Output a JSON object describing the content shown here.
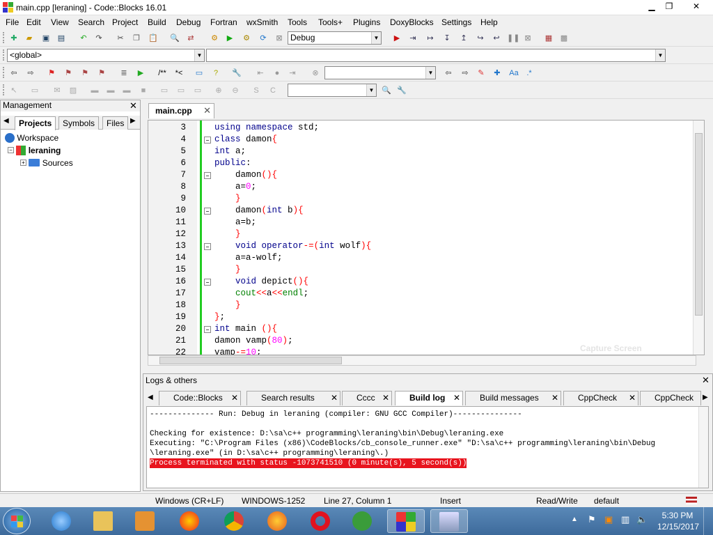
{
  "window": {
    "title": "main.cpp [leraning] - Code::Blocks 16.01"
  },
  "menu": [
    "File",
    "Edit",
    "View",
    "Search",
    "Project",
    "Build",
    "Debug",
    "Fortran",
    "wxSmith",
    "Tools",
    "Tools+",
    "Plugins",
    "DoxyBlocks",
    "Settings",
    "Help"
  ],
  "toolbar": {
    "build_target": "Debug",
    "scope": "<global>",
    "symbol": ""
  },
  "management": {
    "title": "Management",
    "tabs": [
      "Projects",
      "Symbols",
      "Files"
    ],
    "workspace": "Workspace",
    "project": "leraning",
    "folder": "Sources"
  },
  "editor": {
    "tab": "main.cpp",
    "lines": [
      {
        "n": "3",
        "html": "<span class='kw'>using</span> <span class='kw'>namespace</span> std;"
      },
      {
        "n": "4",
        "html": "<span class='kw'>class</span> damon<span class='op'>{</span>"
      },
      {
        "n": "5",
        "html": "<span class='ty'>int</span> a;"
      },
      {
        "n": "6",
        "html": "<span class='kw'>public</span>:"
      },
      {
        "n": "7",
        "html": "    damon<span class='op'>(){</span>"
      },
      {
        "n": "8",
        "html": "    a=<span class='num'>0</span>;"
      },
      {
        "n": "9",
        "html": "    <span class='op'>}</span>"
      },
      {
        "n": "10",
        "html": "    damon<span class='op'>(</span><span class='ty'>int</span> b<span class='op'>){</span>"
      },
      {
        "n": "11",
        "html": "    a=b;"
      },
      {
        "n": "12",
        "html": "    <span class='op'>}</span>"
      },
      {
        "n": "13",
        "html": "    <span class='ty'>void</span> <span class='kw'>operator</span><span class='op'>-=(</span><span class='ty'>int</span> wolf<span class='op'>){</span>"
      },
      {
        "n": "14",
        "html": "    a=a-wolf;"
      },
      {
        "n": "15",
        "html": "    <span class='op'>}</span>"
      },
      {
        "n": "16",
        "html": "    <span class='ty'>void</span> depict<span class='op'>(){</span>"
      },
      {
        "n": "17",
        "html": "    <span style='color:#008000'>cout</span><span class='op'>&lt;&lt;</span>a<span class='op'>&lt;&lt;</span><span style='color:#008000'>endl</span>;"
      },
      {
        "n": "18",
        "html": "    <span class='op'>}</span>"
      },
      {
        "n": "19",
        "html": "<span class='op'>}</span>;"
      },
      {
        "n": "20",
        "html": "<span class='ty'>int</span> main <span class='op'>(){</span>"
      },
      {
        "n": "21",
        "html": "damon vamp<span class='op'>(</span><span class='num'>80</span><span class='op'>)</span>;"
      },
      {
        "n": "22",
        "html": "vamp<span class='op'>-=</span><span class='num'>10</span>;"
      }
    ],
    "watermark": "Capture Screen"
  },
  "logs": {
    "title": "Logs & others",
    "tabs": [
      "Code::Blocks",
      "Search results",
      "Cccc",
      "Build log",
      "Build messages",
      "CppCheck",
      "CppCheck m"
    ],
    "lines": [
      "-------------- Run: Debug in leraning (compiler: GNU GCC Compiler)---------------",
      "",
      "Checking for existence: D:\\sa\\c++ programming\\leraning\\bin\\Debug\\leraning.exe",
      "Executing: \"C:\\Program Files (x86)\\CodeBlocks/cb_console_runner.exe\" \"D:\\sa\\c++ programming\\leraning\\bin\\Debug",
      "\\leraning.exe\"  (in D:\\sa\\c++ programming\\leraning\\.)"
    ],
    "error": "Process terminated with status -1073741510 (0 minute(s), 5 second(s))"
  },
  "status": {
    "eol": "Windows (CR+LF)",
    "encoding": "WINDOWS-1252",
    "position": "Line 27, Column 1",
    "mode": "Insert",
    "access": "Read/Write",
    "profile": "default"
  },
  "clock": {
    "time": "5:30 PM",
    "date": "12/15/2017"
  }
}
